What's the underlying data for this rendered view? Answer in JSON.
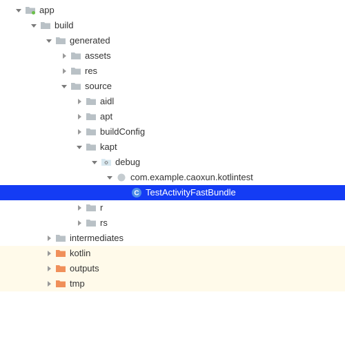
{
  "tree": {
    "nodes": [
      {
        "id": "app",
        "label": "app",
        "depth": 0,
        "expanded": true,
        "icon": "module-folder"
      },
      {
        "id": "build",
        "label": "build",
        "depth": 1,
        "expanded": true,
        "icon": "folder"
      },
      {
        "id": "generated",
        "label": "generated",
        "depth": 2,
        "expanded": true,
        "icon": "folder"
      },
      {
        "id": "assets",
        "label": "assets",
        "depth": 3,
        "expanded": false,
        "icon": "folder"
      },
      {
        "id": "res",
        "label": "res",
        "depth": 3,
        "expanded": false,
        "icon": "folder"
      },
      {
        "id": "source",
        "label": "source",
        "depth": 3,
        "expanded": true,
        "icon": "folder"
      },
      {
        "id": "aidl",
        "label": "aidl",
        "depth": 4,
        "expanded": false,
        "icon": "folder"
      },
      {
        "id": "apt",
        "label": "apt",
        "depth": 4,
        "expanded": false,
        "icon": "folder"
      },
      {
        "id": "buildconfig",
        "label": "buildConfig",
        "depth": 4,
        "expanded": false,
        "icon": "folder"
      },
      {
        "id": "kapt",
        "label": "kapt",
        "depth": 4,
        "expanded": true,
        "icon": "folder"
      },
      {
        "id": "debug",
        "label": "debug",
        "depth": 5,
        "expanded": true,
        "icon": "special-folder"
      },
      {
        "id": "package",
        "label": "com.example.caoxun.kotlintest",
        "depth": 6,
        "expanded": true,
        "icon": "package"
      },
      {
        "id": "testactivity",
        "label": "TestActivityFastBundle",
        "depth": 7,
        "expanded": null,
        "icon": "class",
        "selected": true
      },
      {
        "id": "r",
        "label": "r",
        "depth": 4,
        "expanded": false,
        "icon": "folder"
      },
      {
        "id": "rs",
        "label": "rs",
        "depth": 4,
        "expanded": false,
        "icon": "folder"
      },
      {
        "id": "intermediates",
        "label": "intermediates",
        "depth": 2,
        "expanded": false,
        "icon": "folder"
      },
      {
        "id": "kotlin",
        "label": "kotlin",
        "depth": 2,
        "expanded": false,
        "icon": "kotlin-folder",
        "highlight": true
      },
      {
        "id": "outputs",
        "label": "outputs",
        "depth": 2,
        "expanded": false,
        "icon": "kotlin-folder",
        "highlight": true
      },
      {
        "id": "tmp",
        "label": "tmp",
        "depth": 2,
        "expanded": false,
        "icon": "kotlin-folder",
        "highlight": true
      }
    ]
  },
  "colors": {
    "selection": "#143cf4",
    "highlight": "#fffaea",
    "folder": "#b9c1c6",
    "kotlinFolder": "#f0905a",
    "class": "#4e8ee8"
  }
}
